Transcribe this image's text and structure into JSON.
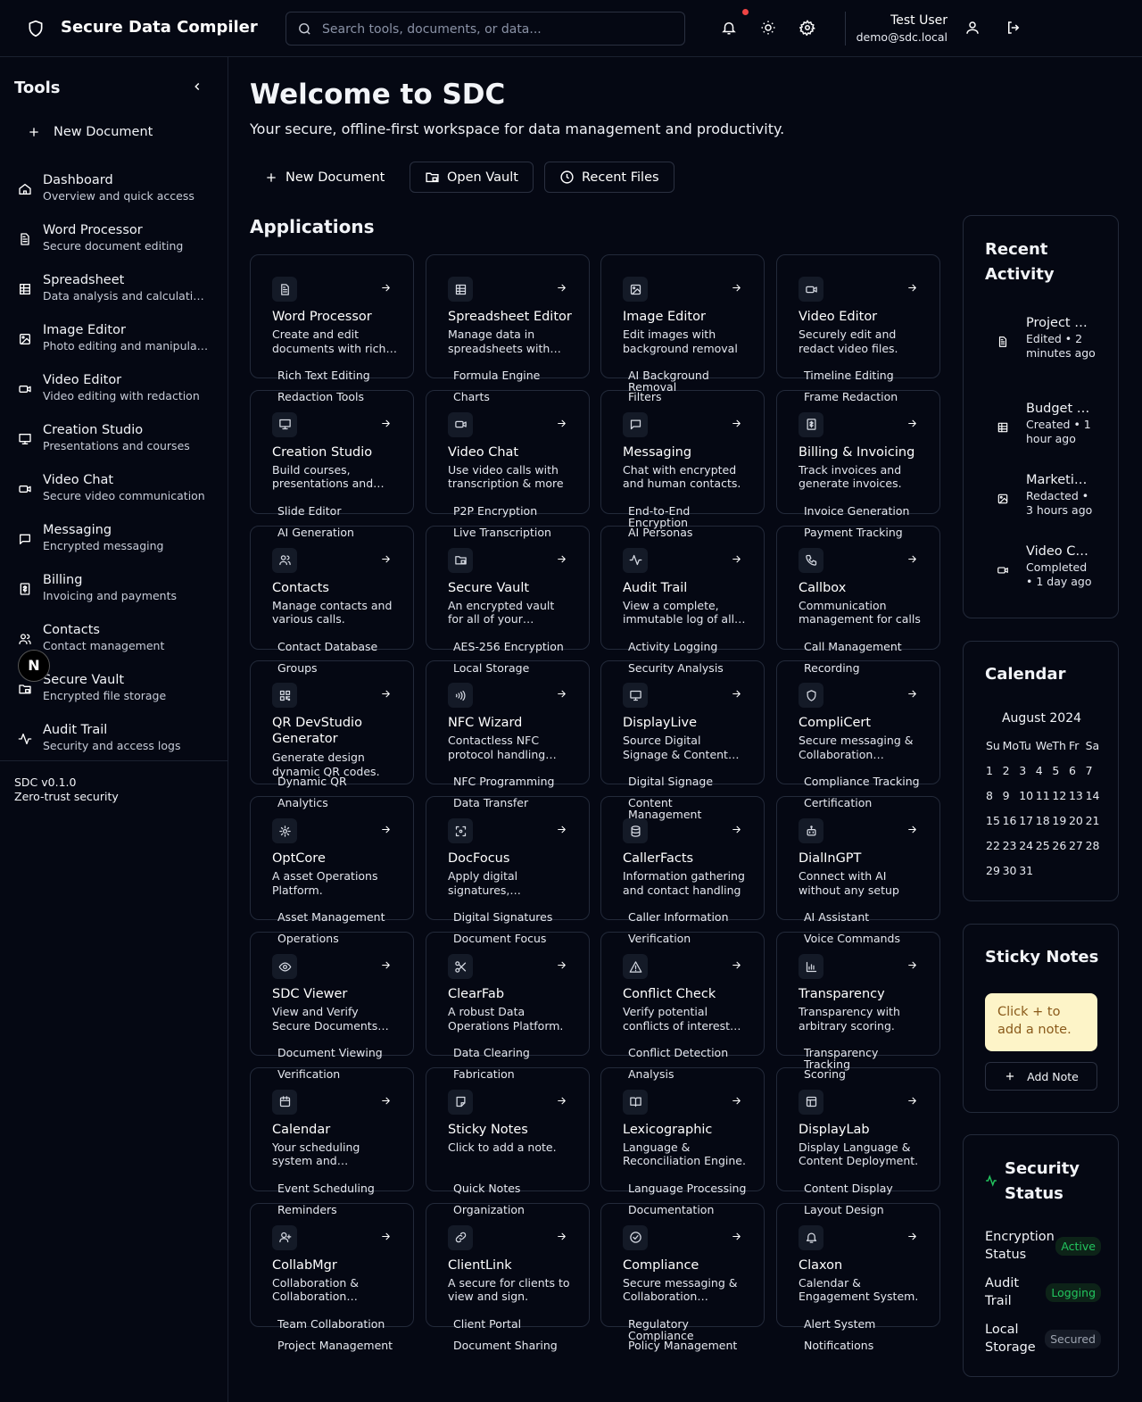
{
  "header": {
    "brand": "Secure Data Compiler",
    "search_placeholder": "Search tools, documents, or data...",
    "user_name": "Test User",
    "user_email": "demo@sdc.local"
  },
  "sidebar": {
    "title": "Tools",
    "new_document": "New Document",
    "items": [
      {
        "label": "Dashboard",
        "desc": "Overview and quick access",
        "icon": "home-icon"
      },
      {
        "label": "Word Processor",
        "desc": "Secure document editing",
        "icon": "document-icon"
      },
      {
        "label": "Spreadsheet",
        "desc": "Data analysis and calculations",
        "icon": "table-icon"
      },
      {
        "label": "Image Editor",
        "desc": "Photo editing and manipulation",
        "icon": "image-icon"
      },
      {
        "label": "Video Editor",
        "desc": "Video editing with redaction",
        "icon": "video-icon"
      },
      {
        "label": "Creation Studio",
        "desc": "Presentations and courses",
        "icon": "presentation-icon"
      },
      {
        "label": "Video Chat",
        "desc": "Secure video communication",
        "icon": "video-icon"
      },
      {
        "label": "Messaging",
        "desc": "Encrypted messaging",
        "icon": "message-icon"
      },
      {
        "label": "Billing",
        "desc": "Invoicing and payments",
        "icon": "receipt-icon"
      },
      {
        "label": "Contacts",
        "desc": "Contact management",
        "icon": "users-icon"
      },
      {
        "label": "Secure Vault",
        "desc": "Encrypted file storage",
        "icon": "folder-lock-icon"
      },
      {
        "label": "Audit Trail",
        "desc": "Security and access logs",
        "icon": "activity-icon"
      }
    ],
    "version": "SDC v0.1.0",
    "tagline": "Zero-trust security",
    "bubble": "N"
  },
  "main": {
    "title": "Welcome to SDC",
    "subtitle": "Your secure, offline-first workspace for data management and productivity.",
    "actions": {
      "new_document": "New Document",
      "open_vault": "Open Vault",
      "recent_files": "Recent Files"
    },
    "apps_title": "Applications",
    "apps": [
      {
        "name": "Word Processor",
        "desc": "Create and edit documents with rich text",
        "tags": [
          "Rich Text Editing",
          "Redaction Tools"
        ],
        "icon": "document-icon"
      },
      {
        "name": "Spreadsheet Editor",
        "desc": "Manage data in spreadsheets with formulas",
        "tags": [
          "Formula Engine",
          "Charts"
        ],
        "icon": "table-icon"
      },
      {
        "name": "Image Editor",
        "desc": "Edit images with background removal",
        "tags": [
          "AI Background Removal",
          "Filters"
        ],
        "icon": "image-icon"
      },
      {
        "name": "Video Editor",
        "desc": "Securely edit and redact video files.",
        "tags": [
          "Timeline Editing",
          "Frame Redaction"
        ],
        "icon": "video-icon"
      },
      {
        "name": "Creation Studio",
        "desc": "Build courses, presentations and more",
        "tags": [
          "Slide Editor",
          "AI Generation"
        ],
        "icon": "presentation-icon"
      },
      {
        "name": "Video Chat",
        "desc": "Use video calls with transcription & more",
        "tags": [
          "P2P Encryption",
          "Live Transcription"
        ],
        "icon": "video-icon"
      },
      {
        "name": "Messaging",
        "desc": "Chat with encrypted and human contacts.",
        "tags": [
          "End-to-End Encryption",
          "AI Personas"
        ],
        "icon": "message-icon"
      },
      {
        "name": "Billing & Invoicing",
        "desc": "Track invoices and generate invoices.",
        "tags": [
          "Invoice Generation",
          "Payment Tracking"
        ],
        "icon": "receipt-icon"
      },
      {
        "name": "Contacts",
        "desc": "Manage contacts and various calls.",
        "tags": [
          "Contact Database",
          "Groups"
        ],
        "icon": "users-icon"
      },
      {
        "name": "Secure Vault",
        "desc": "An encrypted vault for all of your sensitive files",
        "tags": [
          "AES-256 Encryption",
          "Local Storage"
        ],
        "icon": "folder-lock-icon"
      },
      {
        "name": "Audit Trail",
        "desc": "View a complete, immutable log of all actions",
        "tags": [
          "Activity Logging",
          "Security Analysis"
        ],
        "icon": "activity-icon"
      },
      {
        "name": "Callbox",
        "desc": "Communication management for calls",
        "tags": [
          "Call Management",
          "Recording"
        ],
        "icon": "phone-icon"
      },
      {
        "name": "QR DevStudio Generator",
        "desc": "Generate design dynamic QR codes.",
        "tags": [
          "Dynamic QR",
          "Analytics"
        ],
        "icon": "qr-icon"
      },
      {
        "name": "NFC Wizard",
        "desc": "Contactless NFC protocol handling tools",
        "tags": [
          "NFC Programming",
          "Data Transfer"
        ],
        "icon": "nfc-icon"
      },
      {
        "name": "DisplayLive",
        "desc": "Source Digital Signage & Content Management",
        "tags": [
          "Digital Signage",
          "Content Management"
        ],
        "icon": "monitor-icon"
      },
      {
        "name": "CompliCert",
        "desc": "Secure messaging & Collaboration platform",
        "tags": [
          "Compliance Tracking",
          "Certification"
        ],
        "icon": "shield-icon"
      },
      {
        "name": "OptCore",
        "desc": "A asset Operations Platform.",
        "tags": [
          "Asset Management",
          "Operations"
        ],
        "icon": "gear-icon"
      },
      {
        "name": "DocFocus",
        "desc": "Apply digital signatures, documents",
        "tags": [
          "Digital Signatures",
          "Document Focus"
        ],
        "icon": "scan-icon"
      },
      {
        "name": "CallerFacts",
        "desc": "Information gathering and contact handling",
        "tags": [
          "Caller Information",
          "Verification"
        ],
        "icon": "database-icon"
      },
      {
        "name": "DialInGPT",
        "desc": "Connect with AI without any setup",
        "tags": [
          "AI Assistant",
          "Voice Commands"
        ],
        "icon": "bot-icon"
      },
      {
        "name": "SDC Viewer",
        "desc": "View and Verify Secure Documents easily",
        "tags": [
          "Document Viewing",
          "Verification"
        ],
        "icon": "eye-icon"
      },
      {
        "name": "ClearFab",
        "desc": "A robust Data Operations Platform.",
        "tags": [
          "Data Clearing",
          "Fabrication"
        ],
        "icon": "scissors-icon"
      },
      {
        "name": "Conflict Check",
        "desc": "Verify potential conflicts of interest quickly",
        "tags": [
          "Conflict Detection",
          "Analysis"
        ],
        "icon": "warning-icon"
      },
      {
        "name": "Transparency",
        "desc": "Transparency with arbitrary scoring.",
        "tags": [
          "Transparency Tracking",
          "Scoring"
        ],
        "icon": "bar-chart-icon"
      },
      {
        "name": "Calendar",
        "desc": "Your scheduling system and reminders",
        "tags": [
          "Event Scheduling",
          "Reminders"
        ],
        "icon": "calendar-icon"
      },
      {
        "name": "Sticky Notes",
        "desc": "Click to add a note.",
        "tags": [
          "Quick Notes",
          "Organization"
        ],
        "icon": "sticky-note-icon"
      },
      {
        "name": "Lexicographic",
        "desc": "Language & Reconciliation Engine.",
        "tags": [
          "Language Processing",
          "Documentation"
        ],
        "icon": "book-icon"
      },
      {
        "name": "DisplayLab",
        "desc": "Display Language & Content Deployment.",
        "tags": [
          "Content Display",
          "Layout Design"
        ],
        "icon": "layout-icon"
      },
      {
        "name": "CollabMgr",
        "desc": "Collaboration & Collaboration management",
        "tags": [
          "Team Collaboration",
          "Project Management"
        ],
        "icon": "user-plus-icon"
      },
      {
        "name": "ClientLink",
        "desc": "A secure for clients to view and sign.",
        "tags": [
          "Client Portal",
          "Document Sharing"
        ],
        "icon": "link-icon"
      },
      {
        "name": "Compliance",
        "desc": "Secure messaging & Collaboration platform",
        "tags": [
          "Regulatory Compliance",
          "Policy Management"
        ],
        "icon": "check-circle-icon"
      },
      {
        "name": "Claxon",
        "desc": "Calendar & Engagement System.",
        "tags": [
          "Alert System",
          "Notifications"
        ],
        "icon": "bell-icon"
      }
    ]
  },
  "recent_activity": {
    "title": "Recent Activity",
    "items": [
      {
        "title": "Project Proposal",
        "status": "Edited • 2 minutes ago",
        "icon": "document-icon"
      },
      {
        "title": "Budget Sheet",
        "status": "Created • 1 hour ago",
        "icon": "table-icon"
      },
      {
        "title": "Marketing Image",
        "status": "Redacted • 3 hours ago",
        "icon": "image-icon"
      },
      {
        "title": "Video Call",
        "status": "Completed • 1 day ago",
        "icon": "video-icon"
      }
    ]
  },
  "calendar": {
    "title": "Calendar",
    "month": "August 2024",
    "weekdays": [
      "Su",
      "Mo",
      "Tu",
      "We",
      "Th",
      "Fr",
      "Sa"
    ],
    "days": [
      "1",
      "2",
      "3",
      "4",
      "5",
      "6",
      "7",
      "8",
      "9",
      "10",
      "11",
      "12",
      "13",
      "14",
      "15",
      "16",
      "17",
      "18",
      "19",
      "20",
      "21",
      "22",
      "23",
      "24",
      "25",
      "26",
      "27",
      "28",
      "29",
      "30",
      "31"
    ]
  },
  "sticky_notes": {
    "title": "Sticky Notes",
    "note": "Click + to add a note.",
    "add_label": "Add Note"
  },
  "security_status": {
    "title": "Security Status",
    "rows": [
      {
        "label": "Encryption Status",
        "badge": "Active",
        "color": "#22c55e"
      },
      {
        "label": "Audit Trail",
        "badge": "Logging",
        "color": "#22c55e"
      },
      {
        "label": "Local Storage",
        "badge": "Secured",
        "color": "#9ca3af"
      }
    ]
  }
}
